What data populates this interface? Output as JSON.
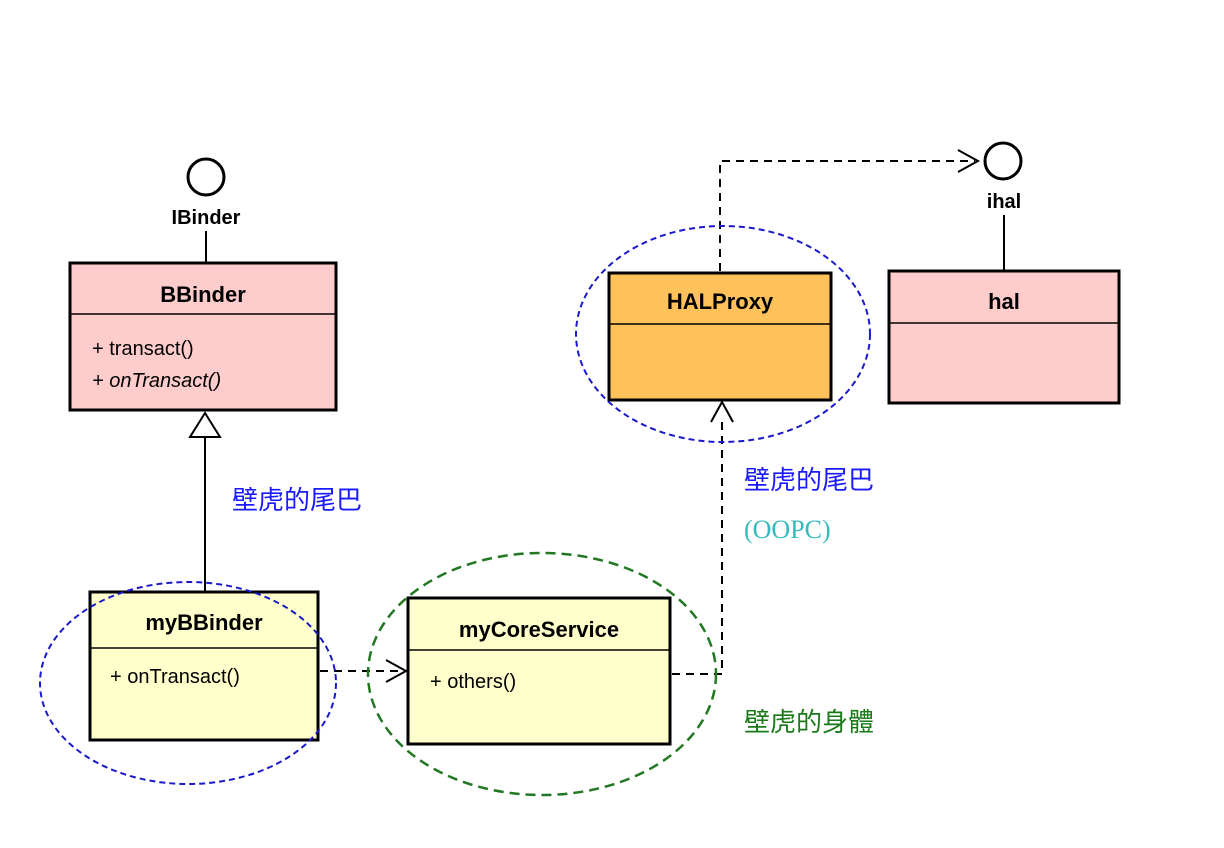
{
  "interfaces": {
    "ibinder": "IBinder",
    "ihal": "ihal"
  },
  "classes": {
    "bbinder": {
      "name": "BBinder",
      "ops": [
        "+ transact()",
        "+ onTransact()"
      ],
      "fill": "#ffcccc"
    },
    "halproxy": {
      "name": "HALProxy",
      "fill": "#ffc25a"
    },
    "hal": {
      "name": "hal",
      "fill": "#ffcccc"
    },
    "mybbinder": {
      "name": "myBBinder",
      "ops": [
        "+ onTransact()"
      ],
      "fill": "#ffffcc"
    },
    "mycoreservice": {
      "name": "myCoreService",
      "ops": [
        "+ others()"
      ],
      "fill": "#ffffcc"
    }
  },
  "annotations": {
    "tail_left": "壁虎的尾巴",
    "tail_right": "壁虎的尾巴",
    "oopc": "(OOPC)",
    "body": "壁虎的身體"
  },
  "colors": {
    "tail": "#1a1aff",
    "oopc": "#33bbbb",
    "body": "#1a7a1a",
    "blue_ellipse": "#1a1acc",
    "green_ellipse": "#227722"
  }
}
